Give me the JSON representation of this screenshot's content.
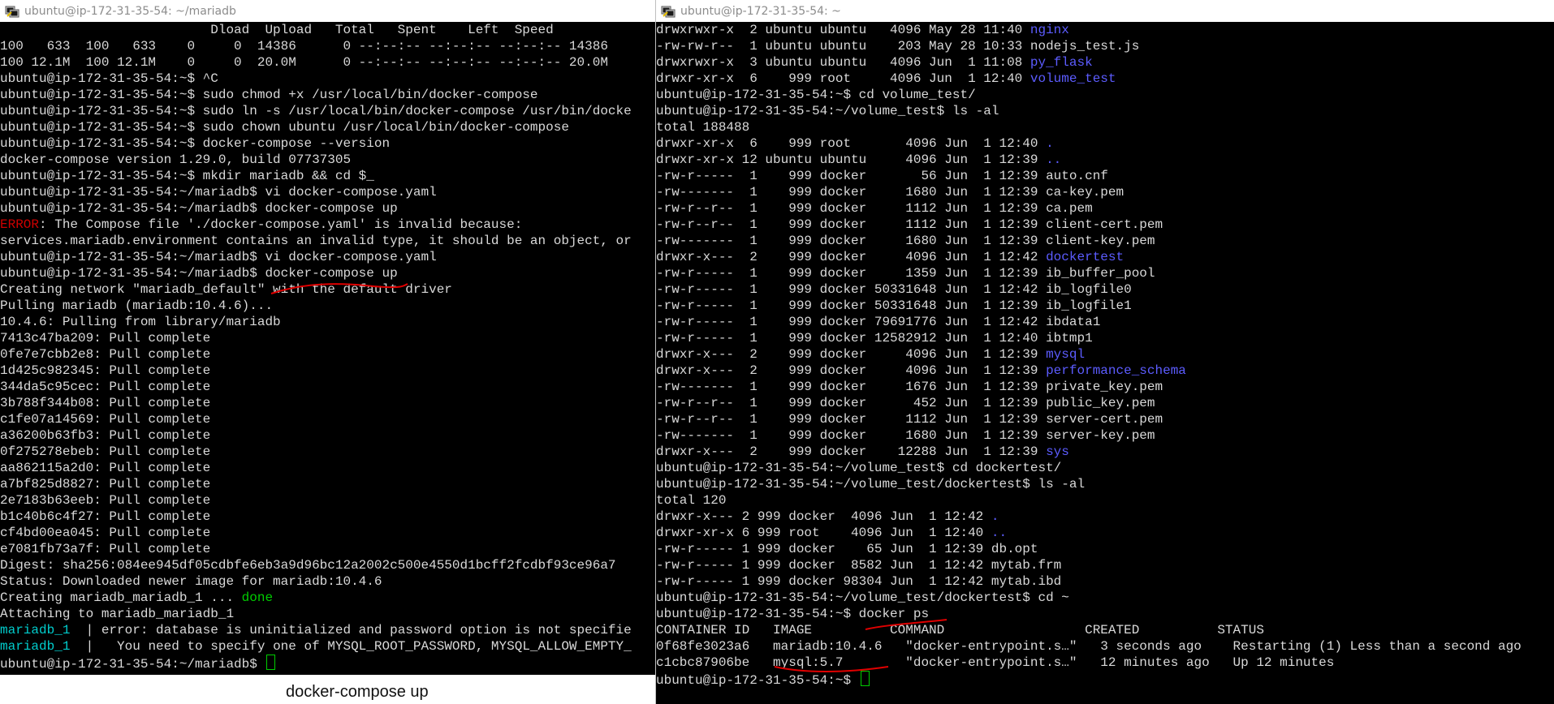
{
  "left_window": {
    "title": "ubuntu@ip-172-31-35-54: ~/mariadb",
    "lines": [
      {
        "parts": [
          {
            "t": "                           Dload  Upload   Total   Spent    Left  Speed"
          }
        ]
      },
      {
        "parts": [
          {
            "t": "100   633  100   633    0     0  14386      0 --:--:-- --:--:-- --:--:-- 14386"
          }
        ]
      },
      {
        "parts": [
          {
            "t": "100 12.1M  100 12.1M    0     0  20.0M      0 --:--:-- --:--:-- --:--:-- 20.0M"
          }
        ]
      },
      {
        "parts": [
          {
            "t": "ubuntu@ip-172-31-35-54:~$ ^C"
          }
        ]
      },
      {
        "parts": [
          {
            "t": "ubuntu@ip-172-31-35-54:~$ sudo chmod +x /usr/local/bin/docker-compose"
          }
        ]
      },
      {
        "parts": [
          {
            "t": "ubuntu@ip-172-31-35-54:~$ sudo ln -s /usr/local/bin/docker-compose /usr/bin/docke"
          }
        ]
      },
      {
        "parts": [
          {
            "t": "ubuntu@ip-172-31-35-54:~$ sudo chown ubuntu /usr/local/bin/docker-compose"
          }
        ]
      },
      {
        "parts": [
          {
            "t": "ubuntu@ip-172-31-35-54:~$ docker-compose --version"
          }
        ]
      },
      {
        "parts": [
          {
            "t": "docker-compose version 1.29.0, build 07737305"
          }
        ]
      },
      {
        "parts": [
          {
            "t": "ubuntu@ip-172-31-35-54:~$ mkdir mariadb && cd $_"
          }
        ]
      },
      {
        "parts": [
          {
            "t": "ubuntu@ip-172-31-35-54:~/mariadb$ vi docker-compose.yaml"
          }
        ]
      },
      {
        "parts": [
          {
            "t": "ubuntu@ip-172-31-35-54:~/mariadb$ docker-compose up"
          }
        ]
      },
      {
        "parts": [
          {
            "t": "ERROR",
            "c": "red"
          },
          {
            "t": ": The Compose file './docker-compose.yaml' is invalid because:"
          }
        ]
      },
      {
        "parts": [
          {
            "t": "services.mariadb.environment contains an invalid type, it should be an object, or"
          }
        ]
      },
      {
        "parts": [
          {
            "t": "ubuntu@ip-172-31-35-54:~/mariadb$ vi docker-compose.yaml"
          }
        ]
      },
      {
        "parts": [
          {
            "t": "ubuntu@ip-172-31-35-54:~/mariadb$ docker-compose up"
          }
        ]
      },
      {
        "parts": [
          {
            "t": "Creating network \"mariadb_default\" with the default driver"
          }
        ]
      },
      {
        "parts": [
          {
            "t": "Pulling mariadb (mariadb:10.4.6)..."
          }
        ]
      },
      {
        "parts": [
          {
            "t": "10.4.6: Pulling from library/mariadb"
          }
        ]
      },
      {
        "parts": [
          {
            "t": "7413c47ba209: Pull complete"
          }
        ]
      },
      {
        "parts": [
          {
            "t": "0fe7e7cbb2e8: Pull complete"
          }
        ]
      },
      {
        "parts": [
          {
            "t": "1d425c982345: Pull complete"
          }
        ]
      },
      {
        "parts": [
          {
            "t": "344da5c95cec: Pull complete"
          }
        ]
      },
      {
        "parts": [
          {
            "t": "3b788f344b08: Pull complete"
          }
        ]
      },
      {
        "parts": [
          {
            "t": "c1fe07a14569: Pull complete"
          }
        ]
      },
      {
        "parts": [
          {
            "t": "a36200b63fb3: Pull complete"
          }
        ]
      },
      {
        "parts": [
          {
            "t": "0f275278ebeb: Pull complete"
          }
        ]
      },
      {
        "parts": [
          {
            "t": "aa862115a2d0: Pull complete"
          }
        ]
      },
      {
        "parts": [
          {
            "t": "a7bf825d8827: Pull complete"
          }
        ]
      },
      {
        "parts": [
          {
            "t": "2e7183b63eeb: Pull complete"
          }
        ]
      },
      {
        "parts": [
          {
            "t": "b1c40b6c4f27: Pull complete"
          }
        ]
      },
      {
        "parts": [
          {
            "t": "cf4bd00ea045: Pull complete"
          }
        ]
      },
      {
        "parts": [
          {
            "t": "e7081fb73a7f: Pull complete"
          }
        ]
      },
      {
        "parts": [
          {
            "t": "Digest: sha256:084ee945df05cdbfe6eb3a9d96bc12a2002c500e4550d1bcff2fcdbf93ce96a7"
          }
        ]
      },
      {
        "parts": [
          {
            "t": "Status: Downloaded newer image for mariadb:10.4.6"
          }
        ]
      },
      {
        "parts": [
          {
            "t": "Creating mariadb_mariadb_1 ... "
          },
          {
            "t": "done",
            "c": "green"
          }
        ]
      },
      {
        "parts": [
          {
            "t": "Attaching to mariadb_mariadb_1"
          }
        ]
      },
      {
        "parts": [
          {
            "t": "mariadb_1",
            "c": "cyan"
          },
          {
            "t": "  | error: database is uninitialized and password option is not specifie"
          }
        ]
      },
      {
        "parts": [
          {
            "t": "mariadb_1",
            "c": "cyan"
          },
          {
            "t": "  |   You need to specify one of MYSQL_ROOT_PASSWORD, MYSQL_ALLOW_EMPTY_"
          }
        ]
      },
      {
        "parts": [
          {
            "t": "ubuntu@ip-172-31-35-54:~/mariadb$ "
          }
        ],
        "cursor": true
      }
    ]
  },
  "right_window": {
    "title": "ubuntu@ip-172-31-35-54: ~",
    "lines": [
      {
        "parts": [
          {
            "t": "drwxrwxr-x  2 ubuntu ubuntu   4096 May 28 11:40 "
          },
          {
            "t": "nginx",
            "c": "blue"
          }
        ]
      },
      {
        "parts": [
          {
            "t": "-rw-rw-r--  1 ubuntu ubuntu    203 May 28 10:33 nodejs_test.js"
          }
        ]
      },
      {
        "parts": [
          {
            "t": "drwxrwxr-x  3 ubuntu ubuntu   4096 Jun  1 11:08 "
          },
          {
            "t": "py_flask",
            "c": "blue"
          }
        ]
      },
      {
        "parts": [
          {
            "t": "drwxr-xr-x  6    999 root     4096 Jun  1 12:40 "
          },
          {
            "t": "volume_test",
            "c": "blue"
          }
        ]
      },
      {
        "parts": [
          {
            "t": "ubuntu@ip-172-31-35-54:~$ cd volume_test/"
          }
        ]
      },
      {
        "parts": [
          {
            "t": "ubuntu@ip-172-31-35-54:~/volume_test$ ls -al"
          }
        ]
      },
      {
        "parts": [
          {
            "t": "total 188488"
          }
        ]
      },
      {
        "parts": [
          {
            "t": "drwxr-xr-x  6    999 root       4096 Jun  1 12:40 "
          },
          {
            "t": ".",
            "c": "blue"
          }
        ]
      },
      {
        "parts": [
          {
            "t": "drwxr-xr-x 12 ubuntu ubuntu     4096 Jun  1 12:39 "
          },
          {
            "t": "..",
            "c": "blue"
          }
        ]
      },
      {
        "parts": [
          {
            "t": "-rw-r-----  1    999 docker       56 Jun  1 12:39 auto.cnf"
          }
        ]
      },
      {
        "parts": [
          {
            "t": "-rw-------  1    999 docker     1680 Jun  1 12:39 ca-key.pem"
          }
        ]
      },
      {
        "parts": [
          {
            "t": "-rw-r--r--  1    999 docker     1112 Jun  1 12:39 ca.pem"
          }
        ]
      },
      {
        "parts": [
          {
            "t": "-rw-r--r--  1    999 docker     1112 Jun  1 12:39 client-cert.pem"
          }
        ]
      },
      {
        "parts": [
          {
            "t": "-rw-------  1    999 docker     1680 Jun  1 12:39 client-key.pem"
          }
        ]
      },
      {
        "parts": [
          {
            "t": "drwxr-x---  2    999 docker     4096 Jun  1 12:42 "
          },
          {
            "t": "dockertest",
            "c": "blue"
          }
        ]
      },
      {
        "parts": [
          {
            "t": "-rw-r-----  1    999 docker     1359 Jun  1 12:39 ib_buffer_pool"
          }
        ]
      },
      {
        "parts": [
          {
            "t": "-rw-r-----  1    999 docker 50331648 Jun  1 12:42 ib_logfile0"
          }
        ]
      },
      {
        "parts": [
          {
            "t": "-rw-r-----  1    999 docker 50331648 Jun  1 12:39 ib_logfile1"
          }
        ]
      },
      {
        "parts": [
          {
            "t": "-rw-r-----  1    999 docker 79691776 Jun  1 12:42 ibdata1"
          }
        ]
      },
      {
        "parts": [
          {
            "t": "-rw-r-----  1    999 docker 12582912 Jun  1 12:40 ibtmp1"
          }
        ]
      },
      {
        "parts": [
          {
            "t": "drwxr-x---  2    999 docker     4096 Jun  1 12:39 "
          },
          {
            "t": "mysql",
            "c": "blue"
          }
        ]
      },
      {
        "parts": [
          {
            "t": "drwxr-x---  2    999 docker     4096 Jun  1 12:39 "
          },
          {
            "t": "performance_schema",
            "c": "blue"
          }
        ]
      },
      {
        "parts": [
          {
            "t": "-rw-------  1    999 docker     1676 Jun  1 12:39 private_key.pem"
          }
        ]
      },
      {
        "parts": [
          {
            "t": "-rw-r--r--  1    999 docker      452 Jun  1 12:39 public_key.pem"
          }
        ]
      },
      {
        "parts": [
          {
            "t": "-rw-r--r--  1    999 docker     1112 Jun  1 12:39 server-cert.pem"
          }
        ]
      },
      {
        "parts": [
          {
            "t": "-rw-------  1    999 docker     1680 Jun  1 12:39 server-key.pem"
          }
        ]
      },
      {
        "parts": [
          {
            "t": "drwxr-x---  2    999 docker    12288 Jun  1 12:39 "
          },
          {
            "t": "sys",
            "c": "blue"
          }
        ]
      },
      {
        "parts": [
          {
            "t": "ubuntu@ip-172-31-35-54:~/volume_test$ cd dockertest/"
          }
        ]
      },
      {
        "parts": [
          {
            "t": "ubuntu@ip-172-31-35-54:~/volume_test/dockertest$ ls -al"
          }
        ]
      },
      {
        "parts": [
          {
            "t": "total 120"
          }
        ]
      },
      {
        "parts": [
          {
            "t": "drwxr-x--- 2 999 docker  4096 Jun  1 12:42 "
          },
          {
            "t": ".",
            "c": "blue"
          }
        ]
      },
      {
        "parts": [
          {
            "t": "drwxr-xr-x 6 999 root    4096 Jun  1 12:40 "
          },
          {
            "t": "..",
            "c": "blue"
          }
        ]
      },
      {
        "parts": [
          {
            "t": "-rw-r----- 1 999 docker    65 Jun  1 12:39 db.opt"
          }
        ]
      },
      {
        "parts": [
          {
            "t": "-rw-r----- 1 999 docker  8582 Jun  1 12:42 mytab.frm"
          }
        ]
      },
      {
        "parts": [
          {
            "t": "-rw-r----- 1 999 docker 98304 Jun  1 12:42 mytab.ibd"
          }
        ]
      },
      {
        "parts": [
          {
            "t": "ubuntu@ip-172-31-35-54:~/volume_test/dockertest$ cd ~"
          }
        ]
      },
      {
        "parts": [
          {
            "t": "ubuntu@ip-172-31-35-54:~$ docker ps"
          }
        ]
      },
      {
        "parts": [
          {
            "t": "CONTAINER ID   IMAGE          COMMAND                  CREATED          STATUS"
          }
        ]
      },
      {
        "parts": [
          {
            "t": "0f68fe3023a6   mariadb:10.4.6   \"docker-entrypoint.s…\"   3 seconds ago    Restarting (1) Less than a second ago"
          }
        ]
      },
      {
        "parts": [
          {
            "t": "c1cbc87906be   mysql:5.7        \"docker-entrypoint.s…\"   12 minutes ago   Up 12 minutes"
          }
        ]
      },
      {
        "parts": [
          {
            "t": "ubuntu@ip-172-31-35-54:~$ "
          }
        ],
        "cursor": true
      }
    ]
  },
  "caption": "docker-compose up",
  "colors": {
    "terminal_bg": "#000000",
    "text": "#d9d9d9",
    "directory": "#5c5cff",
    "error": "#cd0000",
    "success": "#00cd00",
    "service_prefix": "#00cdcd",
    "annotation": "#e00000"
  },
  "icons": [
    "putty-terminal-icon"
  ]
}
